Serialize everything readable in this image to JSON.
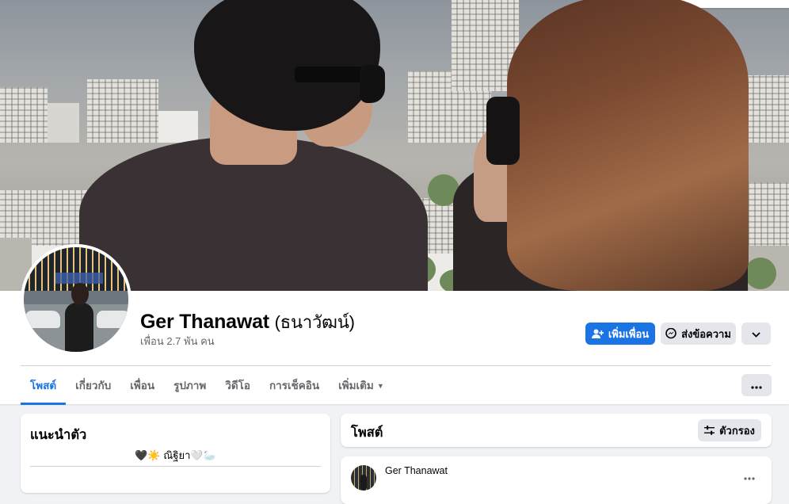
{
  "profile": {
    "name": "Ger Thanawat",
    "alt_name": "(ธนาวัฒน์)",
    "friends": "เพื่อน 2.7 พัน คน"
  },
  "actions": {
    "add_friend": "เพิ่มเพื่อน",
    "message": "ส่งข้อความ",
    "more_icon": "chevron-down-icon"
  },
  "tabs": [
    {
      "label": "โพสต์",
      "active": true
    },
    {
      "label": "เกี่ยวกับ"
    },
    {
      "label": "เพื่อน"
    },
    {
      "label": "รูปภาพ"
    },
    {
      "label": "วิดีโอ"
    },
    {
      "label": "การเช็คอิน"
    },
    {
      "label": "เพิ่มเติม"
    }
  ],
  "intro": {
    "title": "แนะนำตัว",
    "bio": "🖤☀️ ณิฐิยา🤍🦢"
  },
  "posts": {
    "title": "โพสต์",
    "filter_label": "ตัวกรอง",
    "first_post_author": "Ger Thanawat"
  },
  "colors": {
    "accent": "#1b74e4",
    "background": "#f0f2f5"
  }
}
